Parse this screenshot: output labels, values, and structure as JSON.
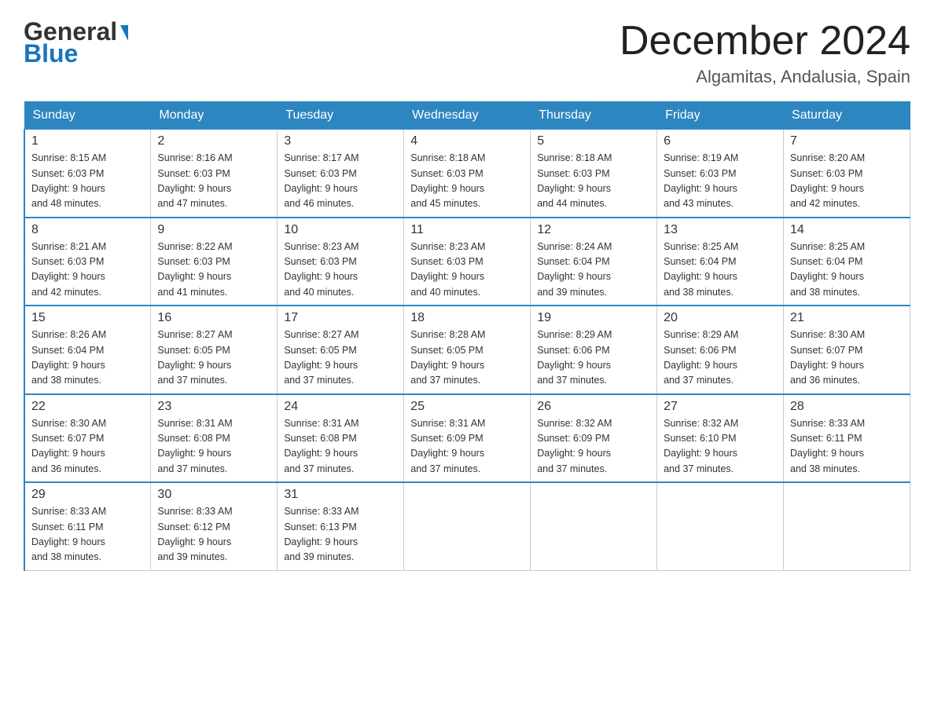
{
  "header": {
    "logo_line1": "General",
    "logo_line2": "Blue",
    "month_title": "December 2024",
    "location": "Algamitas, Andalusia, Spain"
  },
  "days_of_week": [
    "Sunday",
    "Monday",
    "Tuesday",
    "Wednesday",
    "Thursday",
    "Friday",
    "Saturday"
  ],
  "weeks": [
    [
      {
        "day": "1",
        "sunrise": "8:15 AM",
        "sunset": "6:03 PM",
        "daylight": "9 hours and 48 minutes."
      },
      {
        "day": "2",
        "sunrise": "8:16 AM",
        "sunset": "6:03 PM",
        "daylight": "9 hours and 47 minutes."
      },
      {
        "day": "3",
        "sunrise": "8:17 AM",
        "sunset": "6:03 PM",
        "daylight": "9 hours and 46 minutes."
      },
      {
        "day": "4",
        "sunrise": "8:18 AM",
        "sunset": "6:03 PM",
        "daylight": "9 hours and 45 minutes."
      },
      {
        "day": "5",
        "sunrise": "8:18 AM",
        "sunset": "6:03 PM",
        "daylight": "9 hours and 44 minutes."
      },
      {
        "day": "6",
        "sunrise": "8:19 AM",
        "sunset": "6:03 PM",
        "daylight": "9 hours and 43 minutes."
      },
      {
        "day": "7",
        "sunrise": "8:20 AM",
        "sunset": "6:03 PM",
        "daylight": "9 hours and 42 minutes."
      }
    ],
    [
      {
        "day": "8",
        "sunrise": "8:21 AM",
        "sunset": "6:03 PM",
        "daylight": "9 hours and 42 minutes."
      },
      {
        "day": "9",
        "sunrise": "8:22 AM",
        "sunset": "6:03 PM",
        "daylight": "9 hours and 41 minutes."
      },
      {
        "day": "10",
        "sunrise": "8:23 AM",
        "sunset": "6:03 PM",
        "daylight": "9 hours and 40 minutes."
      },
      {
        "day": "11",
        "sunrise": "8:23 AM",
        "sunset": "6:03 PM",
        "daylight": "9 hours and 40 minutes."
      },
      {
        "day": "12",
        "sunrise": "8:24 AM",
        "sunset": "6:04 PM",
        "daylight": "9 hours and 39 minutes."
      },
      {
        "day": "13",
        "sunrise": "8:25 AM",
        "sunset": "6:04 PM",
        "daylight": "9 hours and 38 minutes."
      },
      {
        "day": "14",
        "sunrise": "8:25 AM",
        "sunset": "6:04 PM",
        "daylight": "9 hours and 38 minutes."
      }
    ],
    [
      {
        "day": "15",
        "sunrise": "8:26 AM",
        "sunset": "6:04 PM",
        "daylight": "9 hours and 38 minutes."
      },
      {
        "day": "16",
        "sunrise": "8:27 AM",
        "sunset": "6:05 PM",
        "daylight": "9 hours and 37 minutes."
      },
      {
        "day": "17",
        "sunrise": "8:27 AM",
        "sunset": "6:05 PM",
        "daylight": "9 hours and 37 minutes."
      },
      {
        "day": "18",
        "sunrise": "8:28 AM",
        "sunset": "6:05 PM",
        "daylight": "9 hours and 37 minutes."
      },
      {
        "day": "19",
        "sunrise": "8:29 AM",
        "sunset": "6:06 PM",
        "daylight": "9 hours and 37 minutes."
      },
      {
        "day": "20",
        "sunrise": "8:29 AM",
        "sunset": "6:06 PM",
        "daylight": "9 hours and 37 minutes."
      },
      {
        "day": "21",
        "sunrise": "8:30 AM",
        "sunset": "6:07 PM",
        "daylight": "9 hours and 36 minutes."
      }
    ],
    [
      {
        "day": "22",
        "sunrise": "8:30 AM",
        "sunset": "6:07 PM",
        "daylight": "9 hours and 36 minutes."
      },
      {
        "day": "23",
        "sunrise": "8:31 AM",
        "sunset": "6:08 PM",
        "daylight": "9 hours and 37 minutes."
      },
      {
        "day": "24",
        "sunrise": "8:31 AM",
        "sunset": "6:08 PM",
        "daylight": "9 hours and 37 minutes."
      },
      {
        "day": "25",
        "sunrise": "8:31 AM",
        "sunset": "6:09 PM",
        "daylight": "9 hours and 37 minutes."
      },
      {
        "day": "26",
        "sunrise": "8:32 AM",
        "sunset": "6:09 PM",
        "daylight": "9 hours and 37 minutes."
      },
      {
        "day": "27",
        "sunrise": "8:32 AM",
        "sunset": "6:10 PM",
        "daylight": "9 hours and 37 minutes."
      },
      {
        "day": "28",
        "sunrise": "8:33 AM",
        "sunset": "6:11 PM",
        "daylight": "9 hours and 38 minutes."
      }
    ],
    [
      {
        "day": "29",
        "sunrise": "8:33 AM",
        "sunset": "6:11 PM",
        "daylight": "9 hours and 38 minutes."
      },
      {
        "day": "30",
        "sunrise": "8:33 AM",
        "sunset": "6:12 PM",
        "daylight": "9 hours and 39 minutes."
      },
      {
        "day": "31",
        "sunrise": "8:33 AM",
        "sunset": "6:13 PM",
        "daylight": "9 hours and 39 minutes."
      },
      null,
      null,
      null,
      null
    ]
  ],
  "labels": {
    "sunrise": "Sunrise:",
    "sunset": "Sunset:",
    "daylight": "Daylight:"
  },
  "colors": {
    "header_bg": "#2e86c1",
    "accent": "#1a75bb"
  }
}
